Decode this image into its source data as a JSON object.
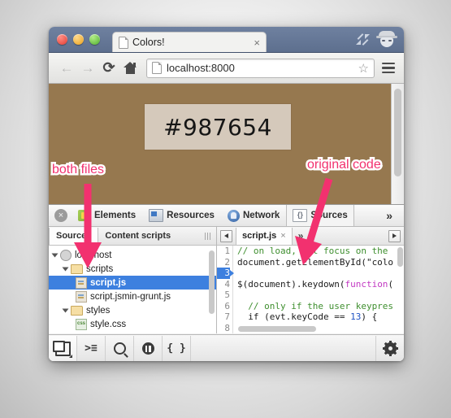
{
  "browser": {
    "tab_title": "Colors!",
    "tab_close": "×",
    "url": "localhost:8000",
    "back_icon": "←",
    "forward_icon": "→",
    "reload_icon": "⟳",
    "star_icon": "☆"
  },
  "page": {
    "color_value": "#987654",
    "background_color": "#96784f",
    "swatch_color": "#d5c9bb"
  },
  "devtools": {
    "close_label": "×",
    "tabs": [
      {
        "label": "Elements",
        "icon": "elements-icon",
        "active": false
      },
      {
        "label": "Resources",
        "icon": "resources-icon",
        "active": false
      },
      {
        "label": "Network",
        "icon": "network-icon",
        "active": false
      },
      {
        "label": "Sources",
        "icon": "sources-icon",
        "active": true
      }
    ],
    "overflow": "»",
    "sidebar": {
      "tabs": [
        {
          "label": "Sources",
          "active": true
        },
        {
          "label": "Content scripts",
          "active": false
        }
      ],
      "tree": [
        {
          "label": "localhost",
          "type": "host",
          "indent": 1,
          "expanded": true,
          "selected": false
        },
        {
          "label": "scripts",
          "type": "folder",
          "indent": 2,
          "expanded": true,
          "selected": false
        },
        {
          "label": "script.js",
          "type": "js",
          "indent": 3,
          "expanded": false,
          "selected": true
        },
        {
          "label": "script.jsmin-grunt.js",
          "type": "js",
          "indent": 3,
          "expanded": false,
          "selected": false
        },
        {
          "label": "styles",
          "type": "folder",
          "indent": 2,
          "expanded": true,
          "selected": false
        },
        {
          "label": "style.css",
          "type": "css",
          "indent": 3,
          "expanded": false,
          "selected": false
        }
      ]
    },
    "editor": {
      "file_tab": "script.js",
      "file_tab_close": "×",
      "more": "»",
      "highlighted_line": 3,
      "lines": [
        {
          "n": 1,
          "tokens": [
            {
              "t": "// on load, put focus on the",
              "c": "cmt"
            }
          ]
        },
        {
          "n": 2,
          "tokens": [
            {
              "t": "document.getElementById(\"colo",
              "c": ""
            }
          ]
        },
        {
          "n": 3,
          "tokens": [
            {
              "t": "",
              "c": ""
            }
          ]
        },
        {
          "n": 4,
          "tokens": [
            {
              "t": "$(document).keydown(",
              "c": ""
            },
            {
              "t": "function",
              "c": "kw"
            },
            {
              "t": "(",
              "c": ""
            }
          ]
        },
        {
          "n": 5,
          "tokens": [
            {
              "t": "",
              "c": ""
            }
          ]
        },
        {
          "n": 6,
          "tokens": [
            {
              "t": "  // only if the user keypres",
              "c": "cmt"
            }
          ]
        },
        {
          "n": 7,
          "tokens": [
            {
              "t": "  if (evt.keyCode == ",
              "c": ""
            },
            {
              "t": "13",
              "c": "num"
            },
            {
              "t": ") {",
              "c": ""
            }
          ]
        },
        {
          "n": 8,
          "tokens": [
            {
              "t": "",
              "c": ""
            }
          ]
        }
      ]
    },
    "bottom_toolbar": [
      {
        "name": "dock-panel-button",
        "icon": "dock-icon"
      },
      {
        "name": "console-drawer-button",
        "icon": "console-prompt-icon",
        "glyph": ">≡"
      },
      {
        "name": "search-button",
        "icon": "magnifier-icon"
      },
      {
        "name": "pause-on-exceptions-button",
        "icon": "pause-icon"
      },
      {
        "name": "pretty-print-button",
        "icon": "braces-icon",
        "glyph": "{ }"
      }
    ],
    "settings_icon": "gear-icon"
  },
  "annotations": [
    {
      "text": "both files",
      "color": "#f2316f"
    },
    {
      "text": "original code",
      "color": "#f2316f"
    }
  ]
}
